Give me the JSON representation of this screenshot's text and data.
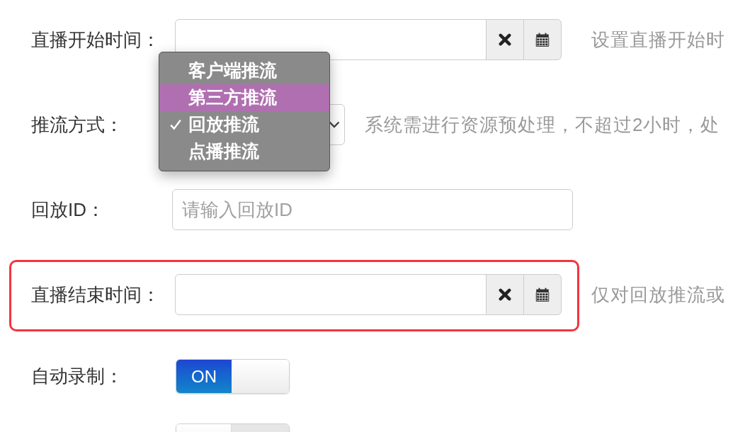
{
  "form": {
    "rows": [
      {
        "kind": "datetime",
        "label": "直播开始时间：",
        "highlighted": false,
        "hint": "设置直播开始时"
      },
      {
        "kind": "select",
        "label": "推流方式：",
        "hint": "系统需进行资源预处理，不超过2小时，处",
        "dropdown": {
          "open": true,
          "options": [
            {
              "label": "客户端推流",
              "selected": false,
              "checked": false
            },
            {
              "label": "第三方推流",
              "selected": true,
              "checked": false
            },
            {
              "label": "回放推流",
              "selected": false,
              "checked": true
            },
            {
              "label": "点播推流",
              "selected": false,
              "checked": false
            }
          ]
        }
      },
      {
        "kind": "text",
        "label": "回放ID：",
        "placeholder": "请输入回放ID"
      },
      {
        "kind": "datetime",
        "label": "直播结束时间：",
        "highlighted": true,
        "hint": "仅对回放推流或"
      },
      {
        "kind": "switch",
        "label": "自动录制：",
        "on": true,
        "on_label": "ON"
      },
      {
        "kind": "switch",
        "on": false
      }
    ]
  }
}
